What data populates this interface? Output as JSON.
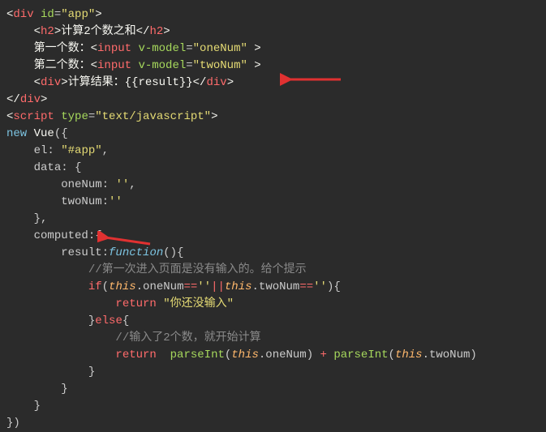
{
  "lines": {
    "l1_id": "\"app\"",
    "l2_title": "计算2个数之和",
    "l3_label": "    第一个数：",
    "l3_model": "\"oneNum\"",
    "l4_label": "    第二个数：",
    "l4_model": "\"twoNum\"",
    "l5_text1": "计算结果：{{result}}",
    "l7_type": "\"text/javascript\"",
    "l8_new": "new",
    "l8_vue": "Vue",
    "l9_el": "el:",
    "l9_val": "\"#app\"",
    "l10_data": "data: {",
    "l11_one": "oneNum:",
    "l11_val": "''",
    "l12_two": "twoNum:",
    "l12_val": "''",
    "l14_comp": "computed:{",
    "l15_res": "result:",
    "l15_fn": "function",
    "c1": "//第一次进入页面是没有输入的。给个提示",
    "if_kw": "if",
    "eq1": "==",
    "v1": "''",
    "or": "||",
    "eq2": "==",
    "v2": "''",
    "ret1": "return",
    "ret1v": "\"你还没输入\"",
    "else_kw": "else",
    "c2": "//输入了2个数，就开始计算",
    "ret2": "return",
    "pi1": "parseInt",
    "pi2": "parseInt",
    "oneNum": ".oneNum",
    "twoNum": ".twoNum"
  }
}
